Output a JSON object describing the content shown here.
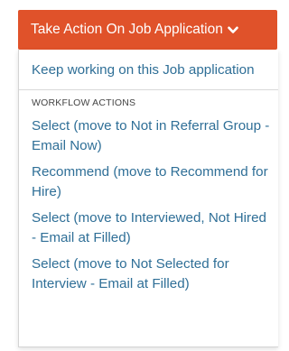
{
  "action_button": {
    "label": "Take Action On Job Application",
    "icon": "chevron-down-icon",
    "color": "#e0522a"
  },
  "menu": {
    "keep_working_label": "Keep working on this Job application",
    "section_header": "WORKFLOW ACTIONS",
    "workflow_actions": [
      "Select (move to Not in Referral Group - Email Now)",
      "Recommend (move to Recommend for Hire)",
      "Select (move to Interviewed, Not Hired - Email at Filled)",
      "Select (move to Not Selected for Interview - Email at Filled)"
    ],
    "link_color": "#2f6f97"
  }
}
